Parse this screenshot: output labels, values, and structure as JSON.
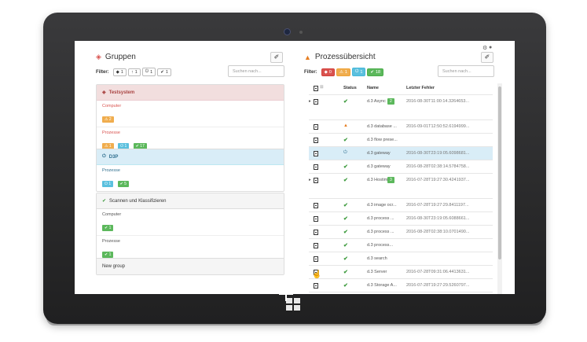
{
  "left": {
    "title": "Gruppen",
    "filter_label": "Filter:",
    "filters": [
      {
        "icon": "diamond-icon",
        "glyph": "◆",
        "count": "1"
      },
      {
        "icon": "arrow-up-icon",
        "glyph": "↑",
        "count": "1"
      },
      {
        "icon": "power-icon",
        "glyph": "⏻",
        "count": "1"
      },
      {
        "icon": "check-icon",
        "glyph": "✔",
        "count": "1"
      }
    ],
    "search_placeholder": "Suchen nach...",
    "groups": [
      {
        "name": "Testsystem",
        "style": "red",
        "icon": "warning-diamond-icon",
        "subs": [
          {
            "label": "Computer",
            "badges": [
              {
                "color": "yellow",
                "text": "⚠ 2"
              }
            ]
          },
          {
            "label": "Prozesse",
            "badges": [
              {
                "color": "yellow",
                "text": "⚠ 1"
              },
              {
                "color": "blue",
                "text": "⏻ 1"
              },
              {
                "color": "green",
                "text": "✔ 17"
              }
            ]
          }
        ]
      },
      {
        "name": "D3P",
        "style": "blue",
        "icon": "power-icon",
        "subs": [
          {
            "label": "Prozesse",
            "badges": [
              {
                "color": "blue",
                "text": "⏻ 1"
              },
              {
                "color": "green",
                "text": "✔ 5"
              }
            ]
          }
        ]
      },
      {
        "name": "Scannen und Klassifizieren",
        "style": "gray",
        "icon": "check-icon",
        "subs": [
          {
            "label": "Computer",
            "badges": [
              {
                "color": "green",
                "text": "✔ 1"
              }
            ]
          },
          {
            "label": "Prozesse",
            "badges": [
              {
                "color": "green",
                "text": "✔ 1"
              }
            ]
          }
        ]
      },
      {
        "name": "New group",
        "style": "gray",
        "icon": "",
        "subs": []
      }
    ]
  },
  "right": {
    "title": "Prozessübersicht",
    "filter_label": "Filter:",
    "filters": [
      {
        "color": "red",
        "glyph": "◆",
        "count": "0"
      },
      {
        "color": "yellow",
        "glyph": "⚠",
        "count": "1"
      },
      {
        "color": "blue",
        "glyph": "⏻",
        "count": "1"
      },
      {
        "color": "green",
        "glyph": "✔",
        "count": "18"
      }
    ],
    "search_placeholder": "Suchen nach...",
    "columns": {
      "status": "Status",
      "name": "Name",
      "error": "Letzter Fehler"
    },
    "rows": [
      {
        "expand": "▸",
        "status": "ok",
        "name": "d.3 Async",
        "badge": "2",
        "error": "2016-08-30T11:00:14.3264653...",
        "tall": true
      },
      {
        "expand": "",
        "status": "warn",
        "name": "d.3 database ...",
        "badge": "",
        "error": "2016-09-01T12:50:52.6194999..."
      },
      {
        "expand": "",
        "status": "ok",
        "name": "d.3 flow prese...",
        "badge": "",
        "error": ""
      },
      {
        "expand": "",
        "status": "power",
        "name": "d.3 gateway",
        "badge": "",
        "error": "2016-08-30T23:19:05.6098681...",
        "selected": true
      },
      {
        "expand": "",
        "status": "ok",
        "name": "d.3 gateway",
        "badge": "",
        "error": "2016-08-28T02:38:14.5784758..."
      },
      {
        "expand": "▸",
        "status": "ok",
        "name": "d.3 Hostim p",
        "badge": "3",
        "error": "2016-07-28T19:27:30.4241937...",
        "tall": true
      },
      {
        "expand": "",
        "status": "ok",
        "name": "d.3 image ocr...",
        "badge": "",
        "error": "2016-07-28T19:27:29.8411197..."
      },
      {
        "expand": "",
        "status": "ok",
        "name": "d.3 process ...",
        "badge": "",
        "error": "2016-08-30T23:19:05.6088661..."
      },
      {
        "expand": "",
        "status": "ok",
        "name": "d.3 process ...",
        "badge": "",
        "error": "2016-08-28T02:38:10.0701490..."
      },
      {
        "expand": "",
        "status": "ok",
        "name": "d.3 process...",
        "badge": "",
        "error": ""
      },
      {
        "expand": "",
        "status": "ok",
        "name": "d.3 search",
        "badge": "",
        "error": ""
      },
      {
        "expand": "",
        "status": "ok",
        "name": "d.3 Server",
        "badge": "",
        "error": "2016-07-28T09:31:06.4413631..."
      },
      {
        "expand": "",
        "status": "ok",
        "name": "d.3 Storage A...",
        "badge": "",
        "error": "2016-07-28T19:27:29.5260797..."
      }
    ]
  }
}
